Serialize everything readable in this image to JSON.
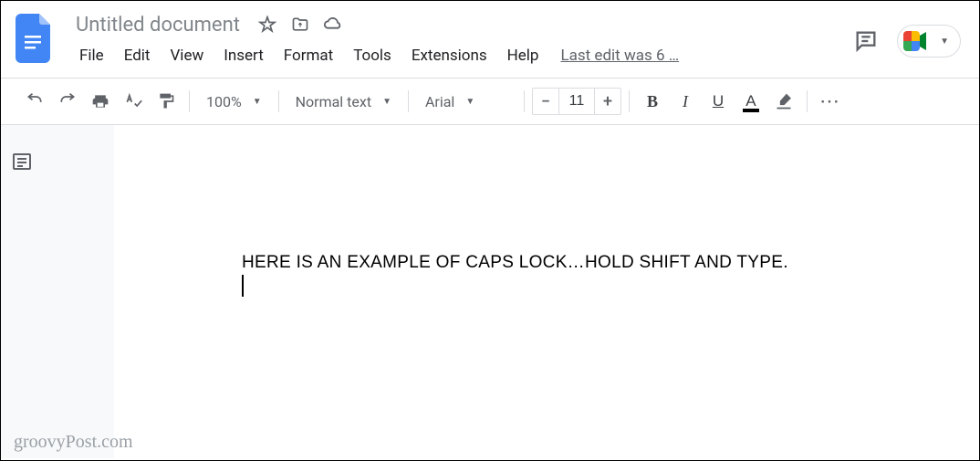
{
  "header": {
    "doc_title": "Untitled document",
    "menus": [
      "File",
      "Edit",
      "View",
      "Insert",
      "Format",
      "Tools",
      "Extensions",
      "Help"
    ],
    "last_edit": "Last edit was 6 …"
  },
  "toolbar": {
    "zoom": "100%",
    "style": "Normal text",
    "font": "Arial",
    "font_size": "11"
  },
  "document": {
    "line1": "HERE IS AN EXAMPLE OF CAPS LOCK…HOLD SHIFT AND TYPE."
  },
  "watermark": "groovyPost.com"
}
